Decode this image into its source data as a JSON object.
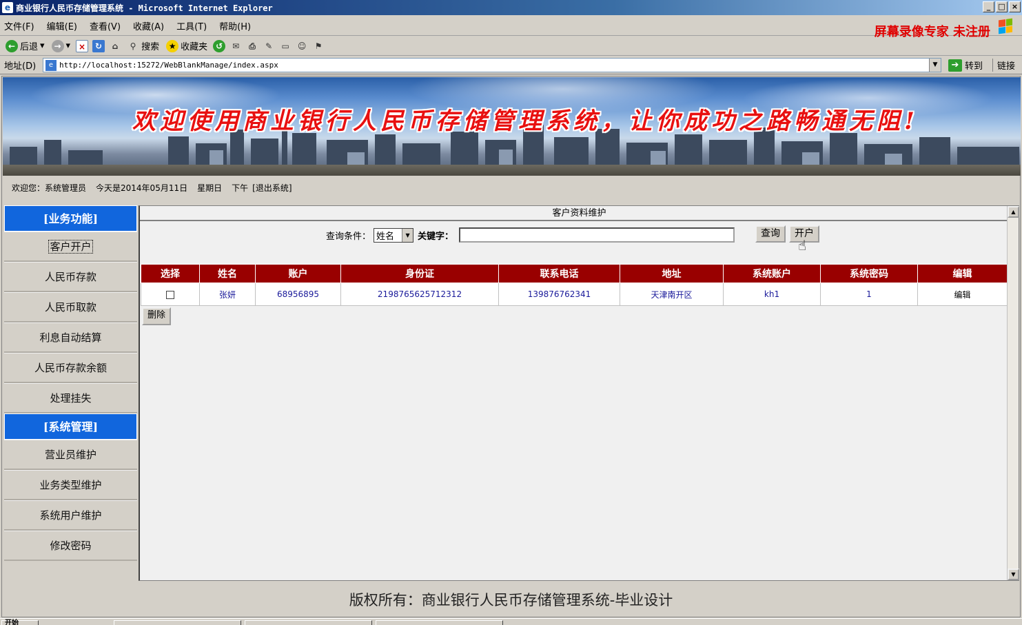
{
  "window": {
    "title": "商业银行人民币存储管理系统 - Microsoft Internet Explorer",
    "buttons": [
      "_",
      "□",
      "×"
    ]
  },
  "menu": [
    "文件(F)",
    "编辑(E)",
    "查看(V)",
    "收藏(A)",
    "工具(T)",
    "帮助(H)"
  ],
  "watermark": "屏幕录像专家 未注册",
  "toolbar": {
    "back": "后退",
    "search": "搜索",
    "favorites": "收藏夹"
  },
  "address": {
    "label": "地址(D)",
    "url": "http://localhost:15272/WebBlankManage/index.aspx",
    "go": "转到",
    "links": "链接"
  },
  "banner": {
    "slogan": "欢迎使用商业银行人民币存储管理系统，让你成功之路畅通无阻!"
  },
  "welcome": {
    "greeting": "欢迎您：系统管理员",
    "date": "今天是2014年05月11日",
    "weekday": "星期日",
    "period": "下午",
    "logout": "[退出系统]"
  },
  "sidebar": {
    "business_header": "[业务功能]",
    "business_items": [
      "客户开户",
      "人民币存款",
      "人民币取款",
      "利息自动结算",
      "人民币存款余额",
      "处理挂失"
    ],
    "system_header": "[系统管理]",
    "system_items": [
      "营业员维护",
      "业务类型维护",
      "系统用户维护",
      "修改密码"
    ]
  },
  "main": {
    "title": "客户资料维护",
    "query_label": "查询条件：",
    "query_field": "姓名",
    "keyword_label": "关键字：",
    "keyword_value": "",
    "query_button": "查询",
    "open_button": "开户",
    "delete_button": "删除",
    "table": {
      "headers": [
        "选择",
        "姓名",
        "账户",
        "身份证",
        "联系电话",
        "地址",
        "系统账户",
        "系统密码",
        "编辑"
      ],
      "rows": [
        {
          "name": "张妍",
          "account": "68956895",
          "id_card": "2198765625712312",
          "phone": "139876762341",
          "address": "天津南开区",
          "sys_account": "kh1",
          "sys_password": "1",
          "edit": "编辑"
        }
      ]
    }
  },
  "footer": "版权所有：商业银行人民币存储管理系统-毕业设计",
  "taskbar": {
    "start": "开始"
  }
}
